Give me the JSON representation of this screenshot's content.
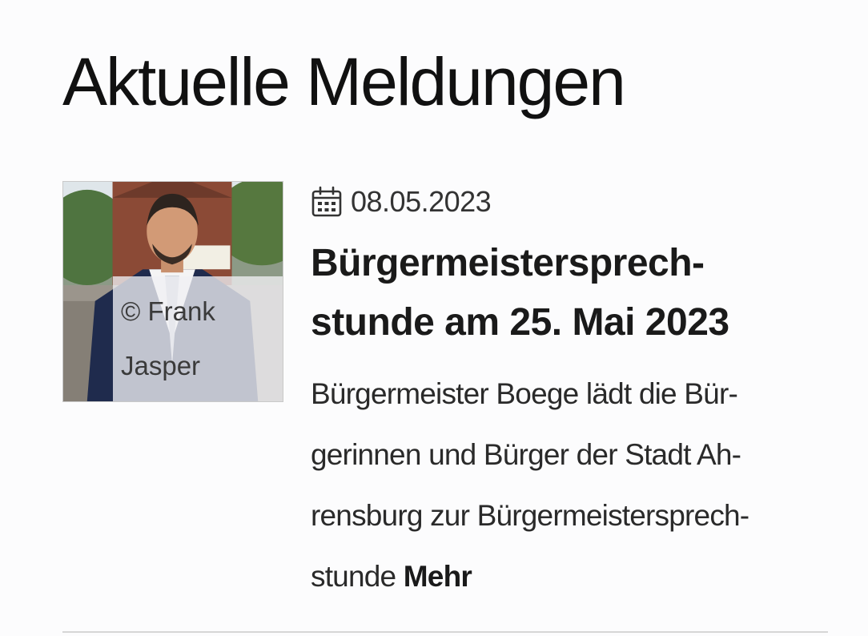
{
  "section": {
    "title": "Aktuelle Meldungen"
  },
  "news": {
    "image_credit": "© Frank Jasper",
    "date_icon": "calendar-icon",
    "date": "08.05.2023",
    "headline_lines": [
      "Bürgermeistersprech-",
      "stunde am 25. Mai 2023"
    ],
    "teaser_lines": [
      "Bürgermeister Boege lädt die Bür-",
      "gerinnen und Bürger der Stadt Ah-",
      "rensburg zur Bürgermeistersprech-",
      "stunde"
    ],
    "more_label": "Mehr"
  }
}
